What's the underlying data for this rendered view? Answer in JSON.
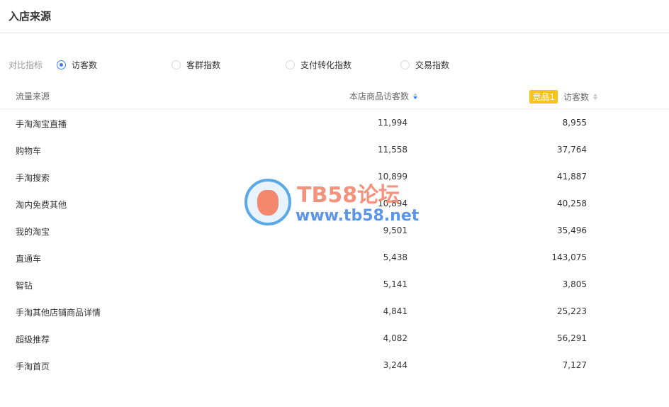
{
  "header": {
    "title": "入店来源"
  },
  "metrics": {
    "label": "对比指标",
    "options": [
      {
        "label": "访客数",
        "checked": true
      },
      {
        "label": "客群指数",
        "checked": false
      },
      {
        "label": "支付转化指数",
        "checked": false
      },
      {
        "label": "交易指数",
        "checked": false
      }
    ]
  },
  "table": {
    "headers": {
      "source": "流量来源",
      "own": "本店商品访客数",
      "competitor_badge": "竞品1",
      "competitor": "访客数"
    },
    "rows": [
      {
        "source": "手淘淘宝直播",
        "own": "11,994",
        "competitor": "8,955"
      },
      {
        "source": "购物车",
        "own": "11,558",
        "competitor": "37,764"
      },
      {
        "source": "手淘搜索",
        "own": "10,899",
        "competitor": "41,887"
      },
      {
        "source": "淘内免费其他",
        "own": "10,894",
        "competitor": "40,258"
      },
      {
        "source": "我的淘宝",
        "own": "9,501",
        "competitor": "35,496"
      },
      {
        "source": "直通车",
        "own": "5,438",
        "competitor": "143,075"
      },
      {
        "source": "智钻",
        "own": "5,141",
        "competitor": "3,805"
      },
      {
        "source": "手淘其他店铺商品详情",
        "own": "4,841",
        "competitor": "25,223"
      },
      {
        "source": "超级推荐",
        "own": "4,082",
        "competitor": "56,291"
      },
      {
        "source": "手淘首页",
        "own": "3,244",
        "competitor": "7,127"
      }
    ]
  },
  "watermark": {
    "title": "TB58论坛",
    "url": "www.tb58.net"
  },
  "colors": {
    "accent": "#3c7cf0",
    "badge": "#f5c518",
    "watermark_red": "#f4876e",
    "watermark_blue": "#4a8ae6"
  }
}
